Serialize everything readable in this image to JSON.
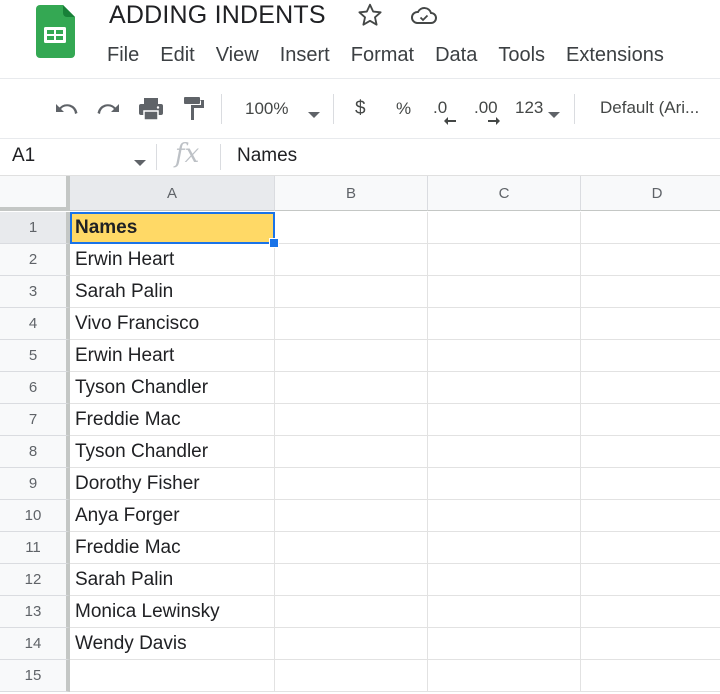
{
  "app": {
    "title": "ADDING INDENTS",
    "menu": [
      "File",
      "Edit",
      "View",
      "Insert",
      "Format",
      "Data",
      "Tools",
      "Extensions"
    ]
  },
  "toolbar": {
    "zoom": "100%",
    "currency": "$",
    "percent": "%",
    "decrease_decimal": ".0",
    "increase_decimal": ".00",
    "number_format": "123",
    "font": "Default (Ari..."
  },
  "formula_bar": {
    "name_box": "A1",
    "fx": "fx",
    "value": "Names"
  },
  "sheet": {
    "columns": [
      "A",
      "B",
      "C",
      "D"
    ],
    "rows": [
      "1",
      "2",
      "3",
      "4",
      "5",
      "6",
      "7",
      "8",
      "9",
      "10",
      "11",
      "12",
      "13",
      "14",
      "15"
    ],
    "column_a": [
      "Names",
      "Erwin Heart",
      "Sarah Palin",
      "Vivo Francisco",
      "Erwin Heart",
      "Tyson Chandler",
      "Freddie Mac",
      "Tyson Chandler",
      "Dorothy Fisher",
      "Anya Forger",
      "Freddie Mac",
      "Sarah Palin",
      "Monica Lewinsky",
      "Wendy Davis",
      ""
    ],
    "selected_cell": "A1",
    "selected_fill": "#ffd966",
    "selection_color": "#1a73e8"
  }
}
